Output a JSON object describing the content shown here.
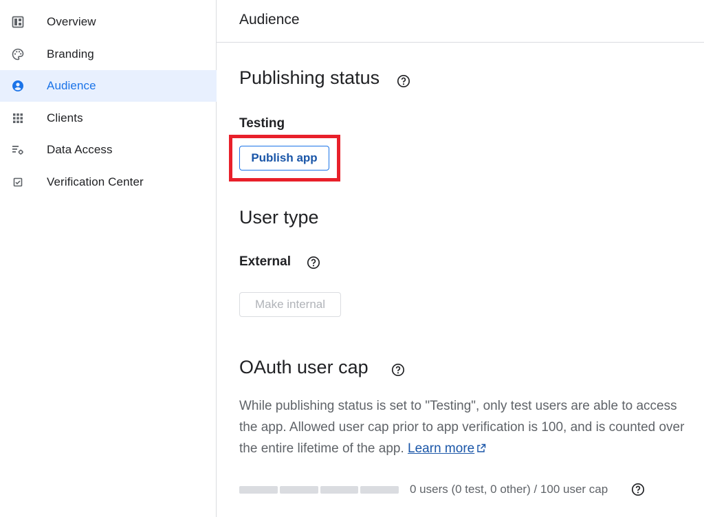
{
  "sidebar": {
    "items": [
      {
        "label": "Overview",
        "icon": "dashboard-icon",
        "active": false
      },
      {
        "label": "Branding",
        "icon": "palette-icon",
        "active": false
      },
      {
        "label": "Audience",
        "icon": "person-icon",
        "active": true
      },
      {
        "label": "Clients",
        "icon": "grid-icon",
        "active": false
      },
      {
        "label": "Data Access",
        "icon": "settings-list-icon",
        "active": false
      },
      {
        "label": "Verification Center",
        "icon": "checkbox-icon",
        "active": false
      }
    ]
  },
  "header": {
    "title": "Audience"
  },
  "publishing": {
    "heading": "Publishing status",
    "status": "Testing",
    "publish_button": "Publish app"
  },
  "user_type": {
    "heading": "User type",
    "value": "External",
    "make_internal_button": "Make internal"
  },
  "oauth_cap": {
    "heading": "OAuth user cap",
    "description": "While publishing status is set to \"Testing\", only test users are able to access the app. Allowed user cap prior to app verification is 100, and is counted over the entire lifetime of the app.",
    "learn_more": "Learn more",
    "usage_text": "0 users (0 test, 0 other) / 100 user cap",
    "usage_fraction": 0
  },
  "colors": {
    "accent": "#1a73e8",
    "active_bg": "#e8f0fe",
    "highlight": "#e8202a"
  }
}
